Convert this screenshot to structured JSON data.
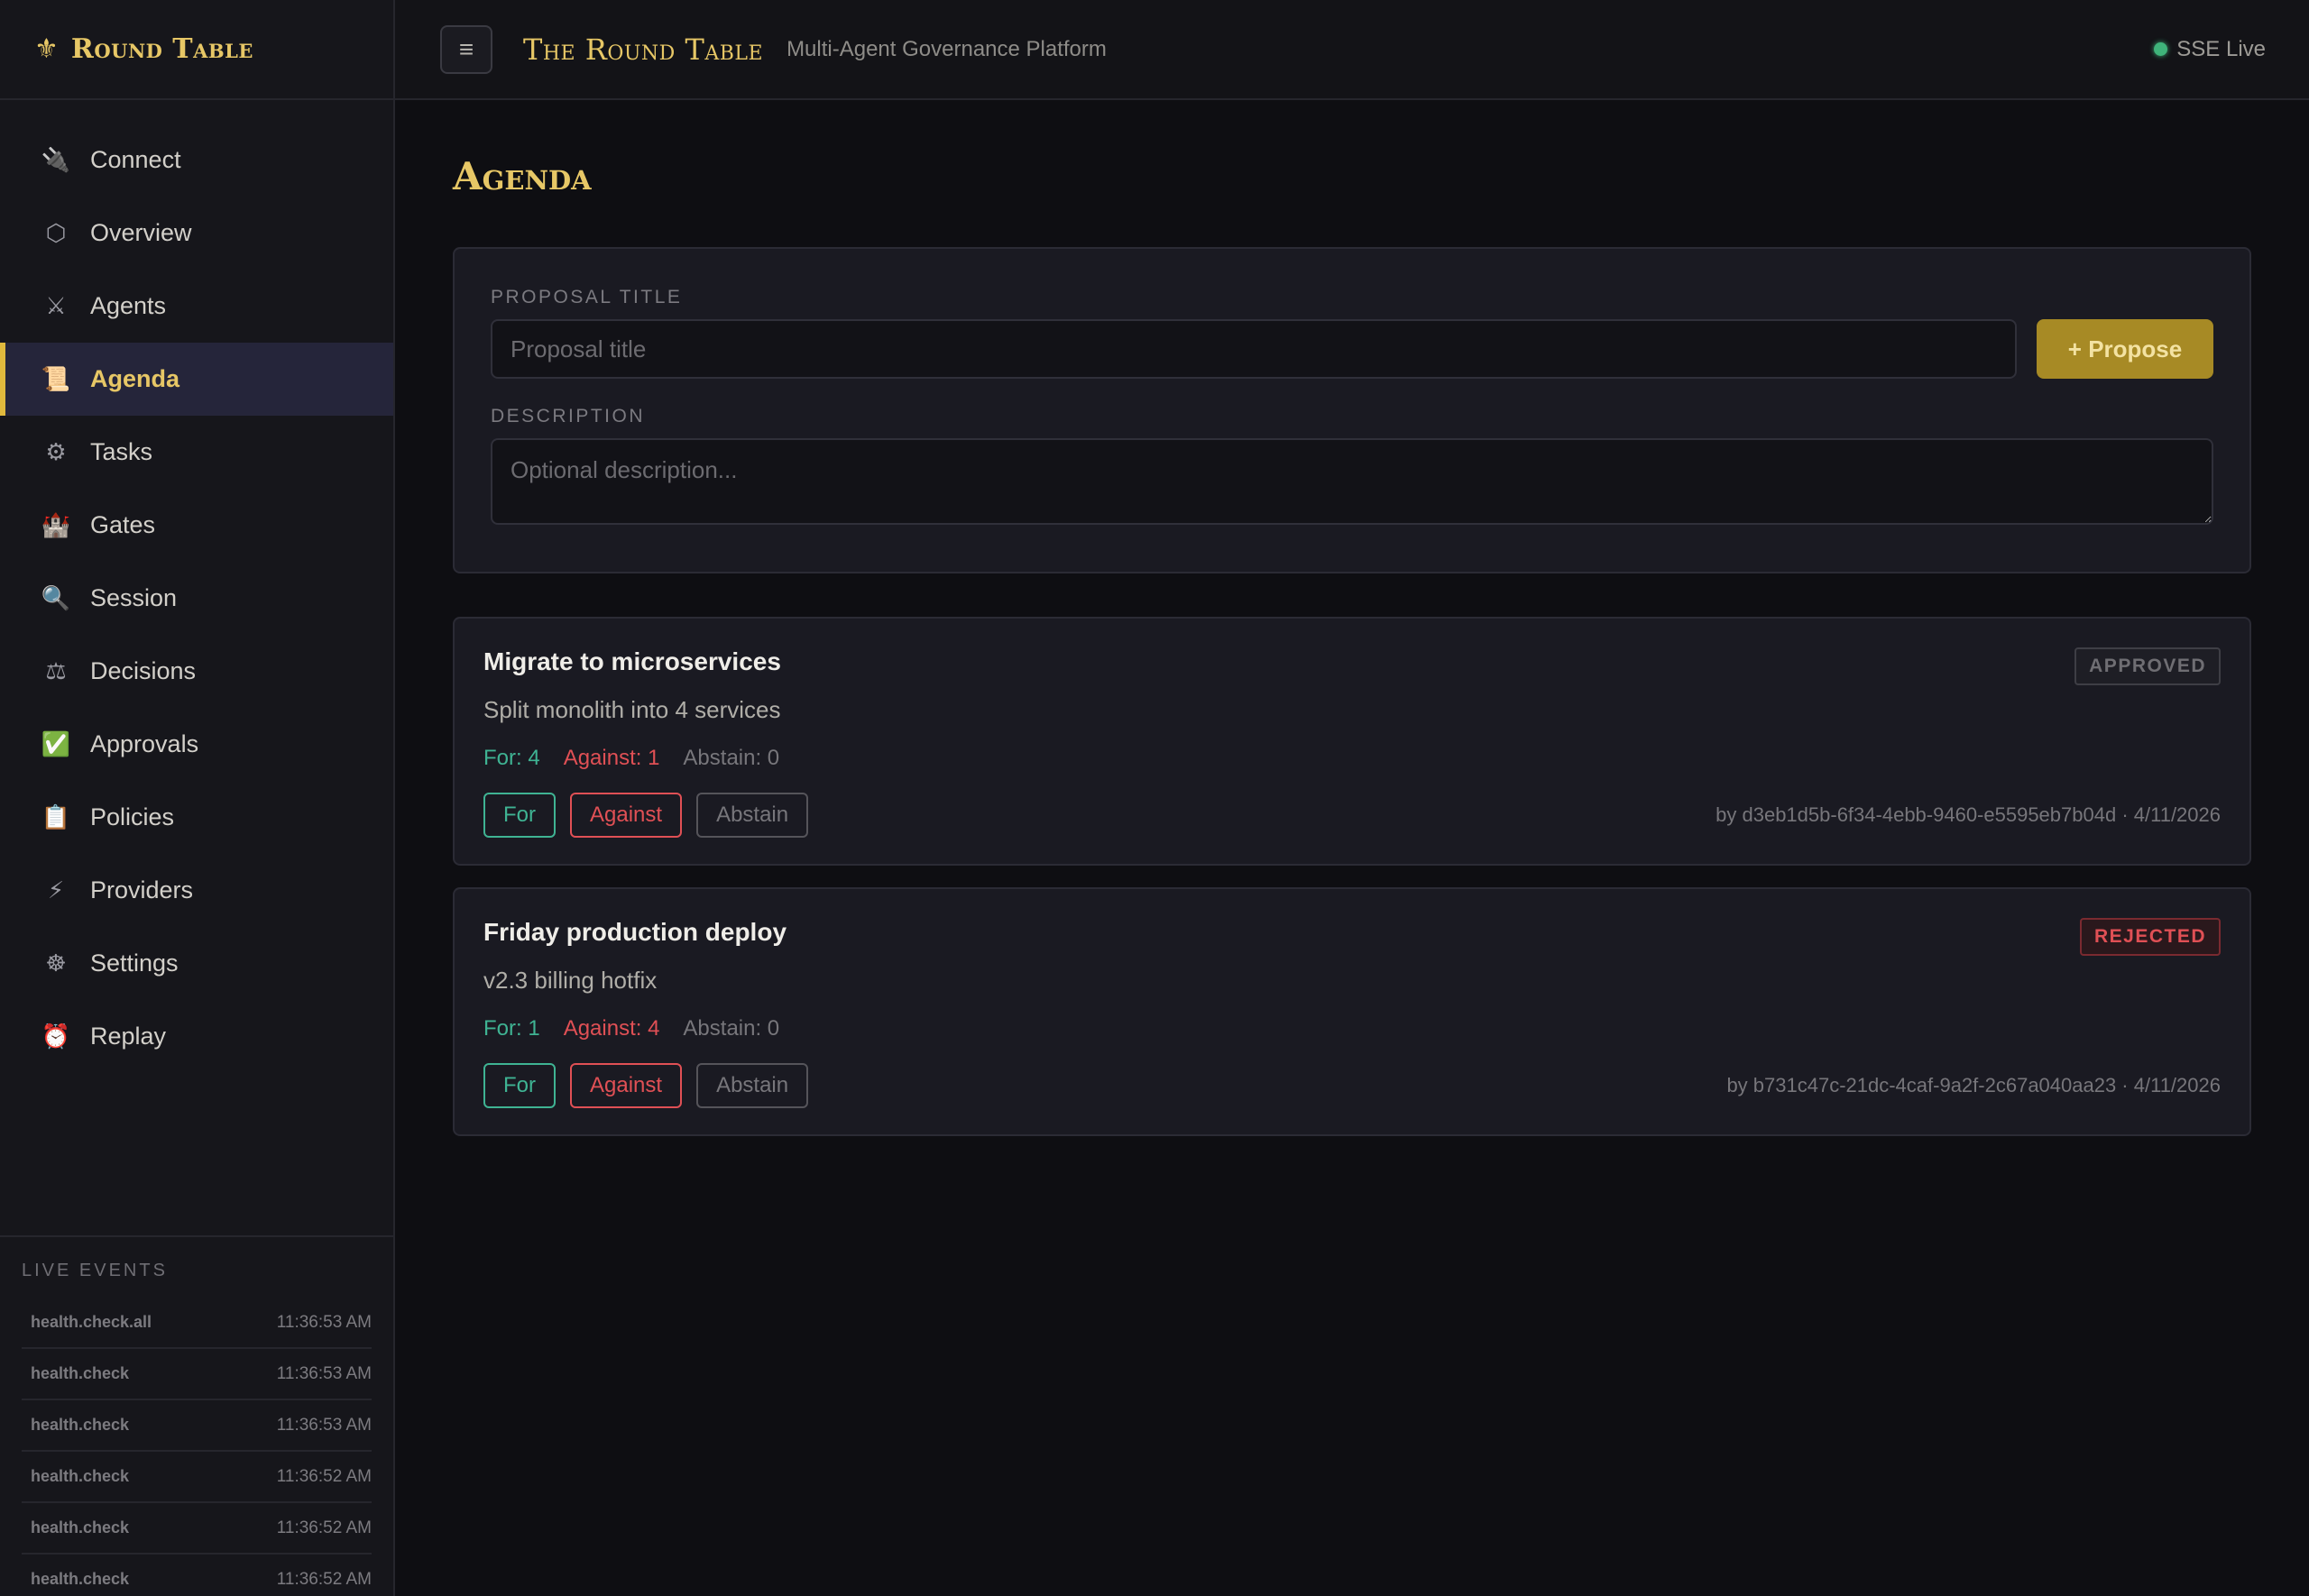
{
  "brand": {
    "icon": "fleur-de-lis-icon",
    "name": "Round Table"
  },
  "sidebar": {
    "items": [
      {
        "label": "Connect",
        "icon": "plug-icon",
        "glyph": "🔌"
      },
      {
        "label": "Overview",
        "icon": "hexagon-icon",
        "glyph": "⬡"
      },
      {
        "label": "Agents",
        "icon": "crossed-swords-icon",
        "glyph": "⚔"
      },
      {
        "label": "Agenda",
        "icon": "scroll-icon",
        "glyph": "📜",
        "active": true
      },
      {
        "label": "Tasks",
        "icon": "gear-icon",
        "glyph": "⚙"
      },
      {
        "label": "Gates",
        "icon": "castle-icon",
        "glyph": "🏰"
      },
      {
        "label": "Session",
        "icon": "magnifier-icon",
        "glyph": "🔍"
      },
      {
        "label": "Decisions",
        "icon": "scales-icon",
        "glyph": "⚖"
      },
      {
        "label": "Approvals",
        "icon": "check-box-icon",
        "glyph": "✅"
      },
      {
        "label": "Policies",
        "icon": "clipboard-icon",
        "glyph": "📋"
      },
      {
        "label": "Providers",
        "icon": "lightning-icon",
        "glyph": "⚡"
      },
      {
        "label": "Settings",
        "icon": "wheel-icon",
        "glyph": "☸"
      },
      {
        "label": "Replay",
        "icon": "alarm-clock-icon",
        "glyph": "⏰"
      }
    ]
  },
  "live_events": {
    "title": "LIVE EVENTS",
    "events": [
      {
        "name": "health.check.all",
        "time": "11:36:53 AM"
      },
      {
        "name": "health.check",
        "time": "11:36:53 AM"
      },
      {
        "name": "health.check",
        "time": "11:36:53 AM"
      },
      {
        "name": "health.check",
        "time": "11:36:52 AM"
      },
      {
        "name": "health.check",
        "time": "11:36:52 AM"
      },
      {
        "name": "health.check",
        "time": "11:36:52 AM"
      }
    ]
  },
  "header": {
    "title": "The Round Table",
    "subtitle": "Multi-Agent Governance Platform",
    "status": "SSE Live",
    "status_color": "#3fb37a"
  },
  "page": {
    "title": "Agenda"
  },
  "form": {
    "title_label": "PROPOSAL TITLE",
    "title_placeholder": "Proposal title",
    "title_value": "",
    "propose_label": "+ Propose",
    "description_label": "DESCRIPTION",
    "description_placeholder": "Optional description...",
    "description_value": ""
  },
  "proposals": [
    {
      "title": "Migrate to microservices",
      "description": "Split monolith into 4 services",
      "status": "APPROVED",
      "tally_for": "For: 4",
      "tally_against": "Against: 1",
      "tally_abstain": "Abstain: 0",
      "btn_for": "For",
      "btn_against": "Against",
      "btn_abstain": "Abstain",
      "meta": "by d3eb1d5b-6f34-4ebb-9460-e5595eb7b04d · 4/11/2026"
    },
    {
      "title": "Friday production deploy",
      "description": "v2.3 billing hotfix",
      "status": "REJECTED",
      "tally_for": "For: 1",
      "tally_against": "Against: 4",
      "tally_abstain": "Abstain: 0",
      "btn_for": "For",
      "btn_against": "Against",
      "btn_abstain": "Abstain",
      "meta": "by b731c47c-21dc-4caf-9a2f-2c67a040aa23 · 4/11/2026"
    }
  ],
  "colors": {
    "accent": "#e7c766",
    "for": "#3fb393",
    "against": "#e05055",
    "abstain": "#77767b"
  }
}
